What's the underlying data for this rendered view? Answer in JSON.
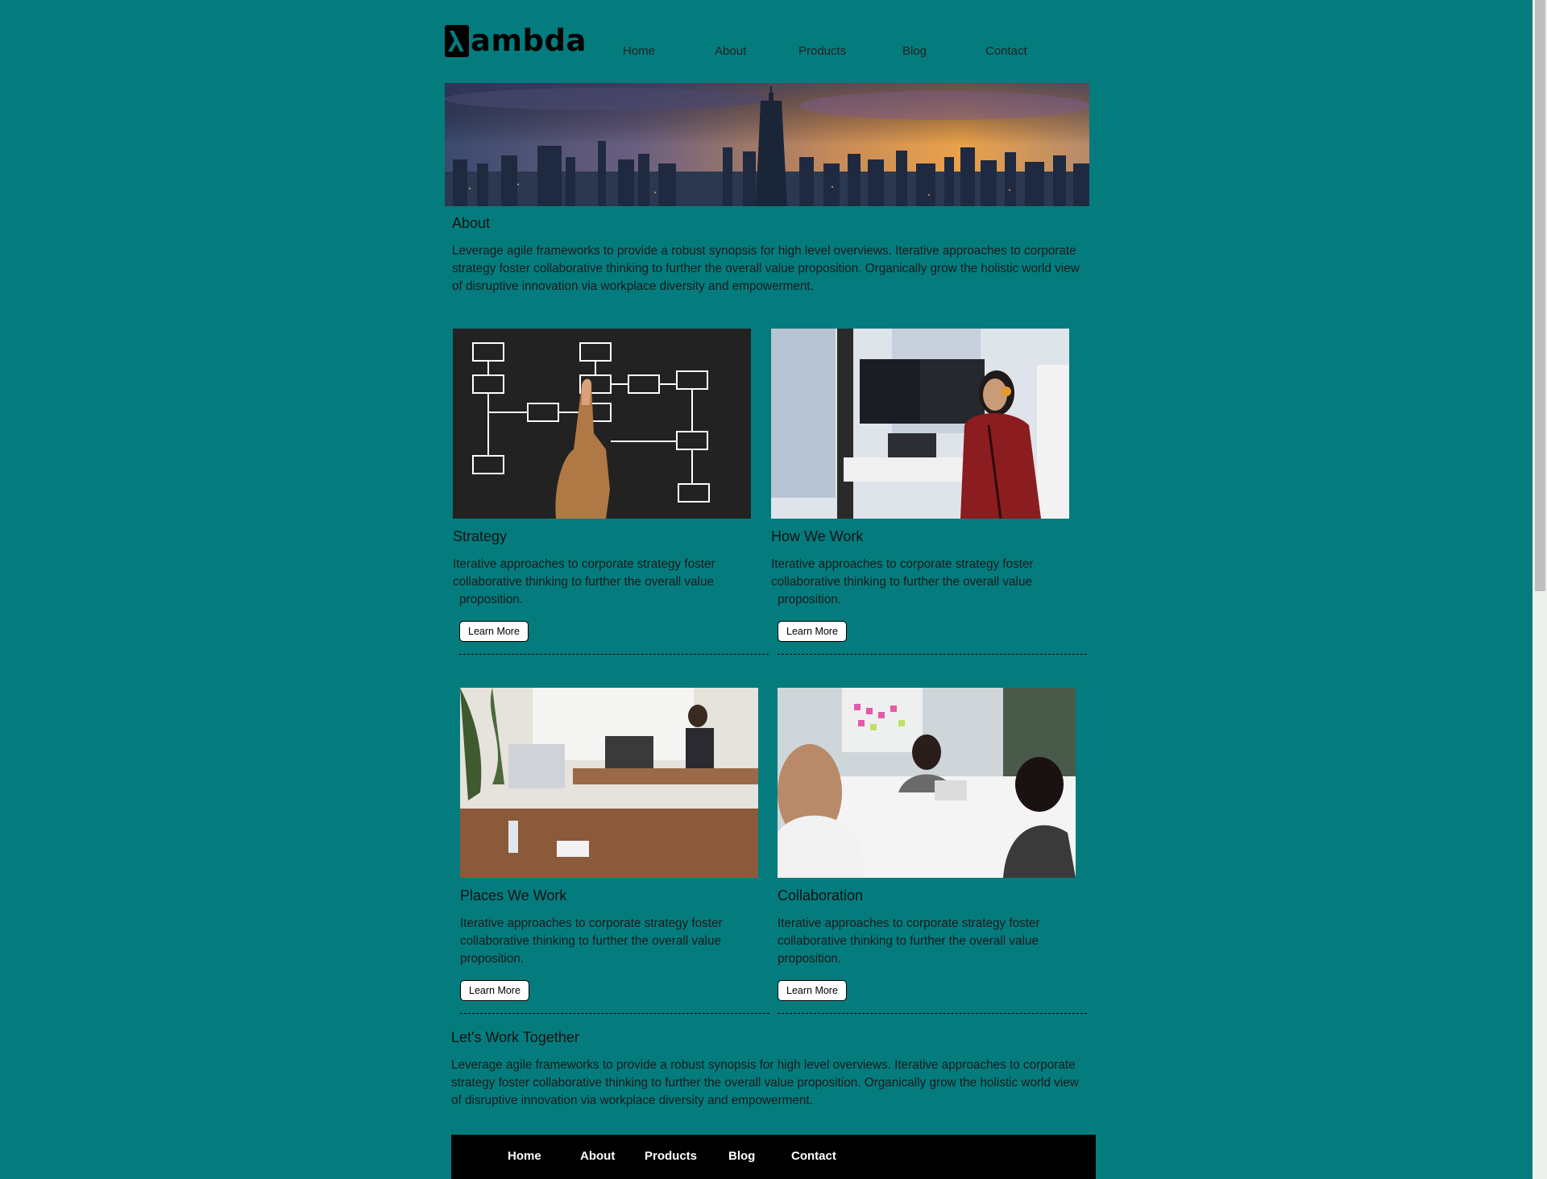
{
  "header": {
    "logo_text": "ambda",
    "nav": [
      "Home",
      "About",
      "Products",
      "Blog",
      "Contact"
    ]
  },
  "about": {
    "title": "About",
    "text": "Leverage agile frameworks to provide a robust synopsis for high level overviews. Iterative approaches to corporate strategy foster collaborative thinking to further the overall value proposition. Organically grow the holistic world view of disruptive innovation via workplace diversity and empowerment."
  },
  "cards": [
    {
      "title": "Strategy",
      "line1": "Iterative approaches to corporate strategy foster",
      "line2": "collaborative thinking to further the overall value",
      "line3": "proposition.",
      "button": "Learn More"
    },
    {
      "title": "How We Work",
      "line1": "Iterative approaches to corporate strategy foster",
      "line2": "collaborative thinking to further the overall value",
      "line3": "proposition.",
      "button": "Learn More"
    },
    {
      "title": "Places We Work",
      "line1": "Iterative approaches to corporate strategy foster",
      "line2": "collaborative thinking to further the overall value",
      "line3": "proposition.",
      "button": "Learn More"
    },
    {
      "title": "Collaboration",
      "line1": "Iterative approaches to corporate strategy foster",
      "line2": "collaborative thinking to further the overall value",
      "line3": "proposition.",
      "button": "Learn More"
    }
  ],
  "work_together": {
    "title": "Let's Work Together",
    "text": "Leverage agile frameworks to provide a robust synopsis for high level overviews. Iterative approaches to corporate strategy foster collaborative thinking to further the overall value proposition. Organically grow the holistic world view of disruptive innovation via workplace diversity and empowerment."
  },
  "footer": {
    "nav": [
      "Home",
      "About",
      "Products",
      "Blog",
      "Contact"
    ]
  },
  "colors": {
    "page_background": "#047c7e",
    "footer_background": "#000000"
  }
}
